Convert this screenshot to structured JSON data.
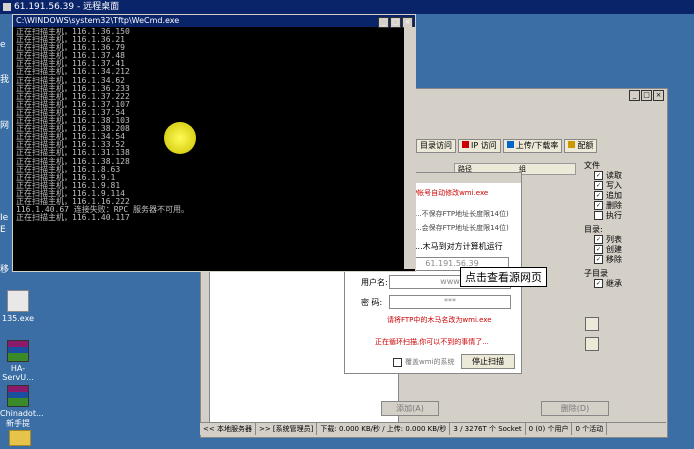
{
  "remote_title": "61.191.56.39 - 远程桌面",
  "desktop": {
    "icons": [
      {
        "label": "135.exe",
        "icon": "exe-icon"
      },
      {
        "label": "HA-ServU...",
        "icon": "rar-icon"
      },
      {
        "label": "Chinadot... 新手提权...",
        "icon": "rar-icon"
      },
      {
        "label": "",
        "icon": "folder-icon"
      }
    ],
    "edge_labels": [
      "e",
      "我",
      "网",
      "Ie",
      "E",
      "移"
    ]
  },
  "cmd": {
    "title": "C:\\WINDOWS\\system32\\Tftp\\WeCmd.exe",
    "lines": [
      "正在扫描主机，116.1.36.150",
      "正在扫描主机，116.1.36.21",
      "正在扫描主机，116.1.36.79",
      "正在扫描主机，116.1.37.48",
      "正在扫描主机，116.1.37.41",
      "正在扫描主机，116.1.34.212",
      "正在扫描主机，116.1.34.62",
      "正在扫描主机，116.1.36.233",
      "正在扫描主机，116.1.37.222",
      "正在扫描主机，116.1.37.107",
      "正在扫描主机，116.1.37.54",
      "正在扫描主机，116.1.38.103",
      "正在扫描主机，116.1.38.208",
      "正在扫描主机，116.1.34.54",
      "正在扫描主机，116.1.33.52",
      "正在扫描主机，116.1.31.138",
      "正在扫描主机，116.1.38.128",
      "正在扫描主机，116.1.8.63",
      "正在扫描主机，116.1.9.1",
      "正在扫描主机，116.1.9.81",
      "正在扫描主机，116.1.9.114",
      "正在扫描主机，116.1.16.222",
      "116.1.40.67 连接失败：RPC 服务器不可用。",
      "正在扫描主机，116.1.40.117"
    ]
  },
  "ftp": {
    "tabs": [
      "目录访问",
      "IP 访问",
      "上传/下载率",
      "配额"
    ],
    "list_head": [
      "路径",
      "组"
    ],
    "file_group": "文件",
    "file_opts": [
      "读取",
      "写入",
      "追加",
      "删除",
      "执行"
    ],
    "dir_group": "目录:",
    "dir_opts": [
      "列表",
      "创建",
      "移除"
    ],
    "sub_group": "子目录",
    "sub_opts": [
      "继承"
    ],
    "btn_add": "添加(A)",
    "btn_del": "删除(D)",
    "status": [
      "<< 本地服务器",
      ">> [系统管理员]",
      "下载: 0.000 KB/秒 / 上传: 0.000 KB/秒",
      "3 / 3276T 个 Socket",
      "0 (0) 个用户",
      "0 个活动"
    ]
  },
  "dialog": {
    "title": "...Beta2",
    "line1": "...的FTP帐号自动修改wmi.exe",
    "opt1": "...不保存FTP地址长度限14位)",
    "opt2": "...会保存FTP地址长度限14位)",
    "hint": "...木马到对方计算机运行",
    "ip": "61.191.56.39",
    "user_label": "用户名:",
    "user_val": "www",
    "pass_label": "密   码:",
    "pass_val": "***",
    "note": "请将FTP中的木马名改为wmi.exe",
    "scanning": "正在循环扫描,你可以不到的事情了...",
    "chk_label": "覆盖wmi的系统",
    "stop": "停止扫描"
  },
  "tooltip": "点击查看源网页"
}
